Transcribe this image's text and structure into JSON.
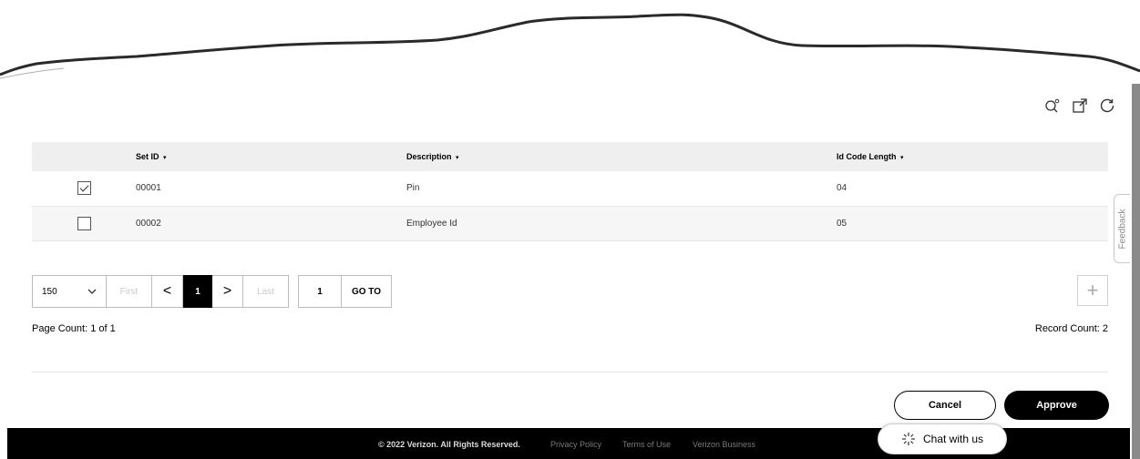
{
  "toolbar": {
    "icons": [
      "search-settings-icon",
      "external-link-icon",
      "refresh-icon"
    ]
  },
  "table": {
    "columns": [
      "Set ID",
      "Description",
      "Id Code Length"
    ],
    "sort_glyph": "▾",
    "rows": [
      {
        "checked": true,
        "set_id": "00001",
        "description": "Pin",
        "id_code_length": "04"
      },
      {
        "checked": false,
        "set_id": "00002",
        "description": "Employee Id",
        "id_code_length": "05"
      }
    ]
  },
  "pagination": {
    "page_size": "150",
    "first_label": "First",
    "prev_glyph": "<",
    "current_page": "1",
    "next_glyph": ">",
    "last_label": "Last",
    "goto_value": "1",
    "goto_label": "GO TO",
    "add_glyph": "+"
  },
  "counts": {
    "page_count_label": "Page Count:",
    "page_count_value": "1 of 1",
    "record_count_label": "Record Count:",
    "record_count_value": "2"
  },
  "actions": {
    "cancel_label": "Cancel",
    "approve_label": "Approve"
  },
  "footer": {
    "copyright": "© 2022 Verizon. All Rights Reserved.",
    "links": [
      "Privacy Policy",
      "Terms of Use",
      "Verizon Business"
    ]
  },
  "chat": {
    "label": "Chat with us"
  },
  "feedback": {
    "label": "Feedback"
  },
  "colors": {
    "accent": "#000000",
    "header_bg": "#efefef",
    "footer_bg": "#000000"
  }
}
